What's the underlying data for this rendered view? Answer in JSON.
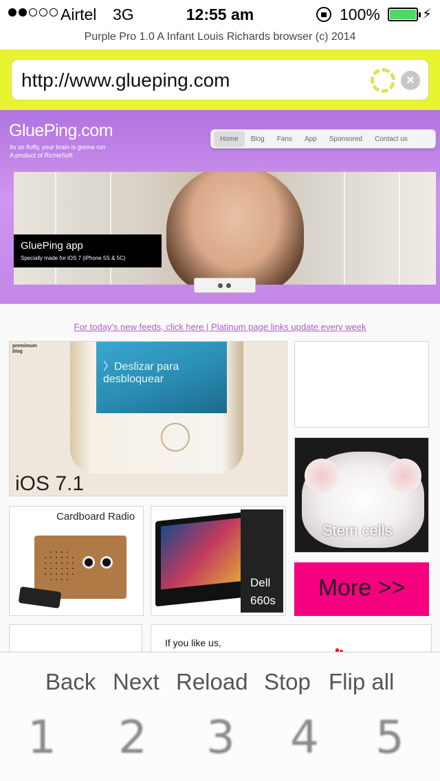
{
  "status_bar": {
    "carrier": "Airtel",
    "network": "3G",
    "time": "12:55 am",
    "battery_percent": "100%",
    "signal_bars_filled": 2,
    "signal_bars_total": 5
  },
  "app": {
    "title": "Purple Pro 1.0  A Infant Louis Richards browser (c) 2014"
  },
  "url_bar": {
    "value": "http://www.glueping.com",
    "accent_color": "#e8f42e"
  },
  "site": {
    "logo": "GluePing.com",
    "tagline_1": "Its so fluffy, your brain is gonna run",
    "tagline_2": "A product of RichieSoft",
    "nav": [
      "Home",
      "Blog",
      "Fans",
      "App",
      "Sponsored",
      "Contact us"
    ],
    "banner_caption_title": "GluePing app",
    "banner_caption_sub": "Specially made for iOS 7 (iPhone 5S & 5C)",
    "feed_link": "For today's new feeds, click here | Platinum page links update every week",
    "ios_tag_1": "premimum",
    "ios_tag_2": "blog",
    "ios_screen_text": "〉Deslizar para desbloquear",
    "ios_label": "iOS 7.1",
    "stem_label": "Stem cells",
    "radio_label": "Cardboard Radio",
    "dell_label_1": "Dell",
    "dell_label_2": "660s",
    "more_label": "More >>",
    "likeus_text": "If you like us,",
    "more_color": "#f5007f",
    "hero_color": "#c287e8"
  },
  "toolbar": {
    "back": "Back",
    "next": "Next",
    "reload": "Reload",
    "stop": "Stop",
    "flip_all": "Flip all",
    "tabs": [
      "1",
      "2",
      "3",
      "4",
      "5"
    ]
  }
}
